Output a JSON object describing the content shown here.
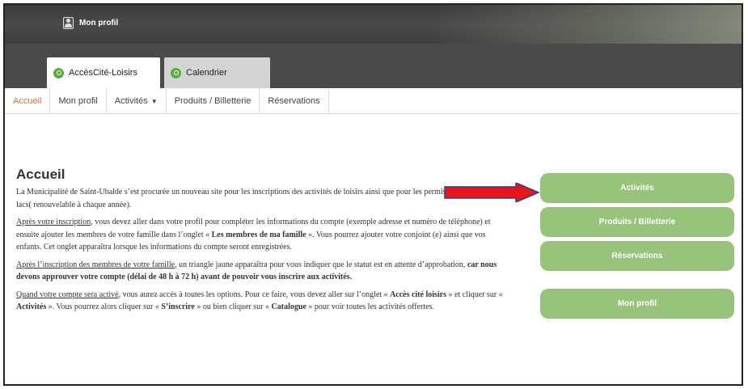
{
  "header": {
    "profile_label": "Mon profil"
  },
  "tabs": [
    {
      "label": "AccèsCité-Loisirs"
    },
    {
      "label": "Calendrier"
    }
  ],
  "menu": [
    {
      "label": "Accueil"
    },
    {
      "label": "Mon profil"
    },
    {
      "label": "Activités",
      "caret": "▼"
    },
    {
      "label": "Produits / Billetterie"
    },
    {
      "label": "Réservations"
    }
  ],
  "page": {
    "title": "Accueil",
    "p1": "La Municipalité de Saint-Ubalde s’est procurée un nouveau site pour les inscriptions des activités de loisirs ainsi que pour les permis d’embarcation aux lacs( renouvelable à chaque année).",
    "p2": {
      "link": "Après votre inscription",
      "a": ", vous devez aller dans votre profil pour compléter les informations du compte (exemple adresse et numéro de téléphone) et ensuite ajouter les membres de votre famille dans l’onglet « ",
      "b": "Les membres de ma famille",
      "c": " ». Vous pourrez ajouter votre conjoint (e) ainsi que vos enfants. Cet onglet apparaîtra lorsque les informations du compte seront enregistrées."
    },
    "p3": {
      "link": "Après l’inscription des membres de votre famille",
      "a": ", un triangle jaune apparaîtra pour vous indiquer que le statut est en attente d’approbation, ",
      "b": "car nous devons approuver votre compte (délai de 48 h à 72 h) avant de pouvoir vous inscrire aux activités."
    },
    "p4": {
      "link": "Quand votre compte sera activé",
      "a": ", vous aurez accès à toutes les options. Pour ce faire, vous devez aller sur l’onglet « ",
      "b1": "Accès cité loisirs",
      "c": " » et cliquer sur « ",
      "b2": "Activités",
      "d": " ». Vous pourrez alors cliquer sur « ",
      "b3": "S’inscrire",
      "e": " » ou bien cliquer sur « ",
      "b4": "Catalogue",
      "f": " » pour voir toutes les activités offertes."
    }
  },
  "sidebar": {
    "buttons": [
      {
        "label": "Activités"
      },
      {
        "label": "Produits / Billetterie"
      },
      {
        "label": "Réservations"
      },
      {
        "label": "Mon profil"
      }
    ]
  },
  "colors": {
    "accent_green": "#97c37a",
    "active_menu": "#e2733a",
    "arrow_red": "#e8151b",
    "arrow_blue": "#2b3f8c"
  }
}
